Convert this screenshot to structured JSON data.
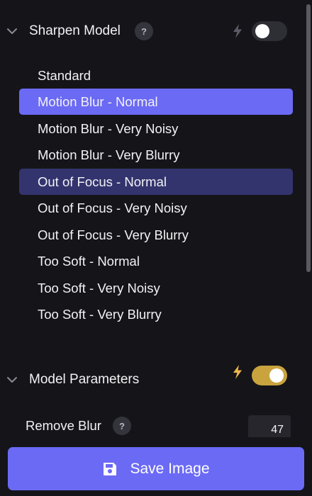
{
  "sharpen_model": {
    "title": "Sharpen Model",
    "help": "?",
    "toggle_on": false,
    "models": [
      {
        "label": "Standard",
        "state": "normal"
      },
      {
        "label": "Motion Blur - Normal",
        "state": "active"
      },
      {
        "label": "Motion Blur - Very Noisy",
        "state": "normal"
      },
      {
        "label": "Motion Blur - Very Blurry",
        "state": "normal"
      },
      {
        "label": "Out of Focus - Normal",
        "state": "hover"
      },
      {
        "label": "Out of Focus - Very Noisy",
        "state": "normal"
      },
      {
        "label": "Out of Focus - Very Blurry",
        "state": "normal"
      },
      {
        "label": "Too Soft - Normal",
        "state": "normal"
      },
      {
        "label": "Too Soft - Very Noisy",
        "state": "normal"
      },
      {
        "label": "Too Soft - Very Blurry",
        "state": "normal"
      }
    ]
  },
  "model_parameters": {
    "title": "Model Parameters",
    "toggle_on": true,
    "remove_blur": {
      "label": "Remove Blur",
      "help": "?",
      "value": "47"
    }
  },
  "footer": {
    "save_label": "Save Image",
    "save_icon": "floppy-disk-icon"
  },
  "colors": {
    "background": "#151519",
    "accent": "#6b6af5",
    "hover": "#33346e",
    "toggle_on": "#c9a43e",
    "toggle_off": "#2e2e35",
    "bolt_on": "#f0b84a",
    "bolt_off": "#5c5c66"
  }
}
